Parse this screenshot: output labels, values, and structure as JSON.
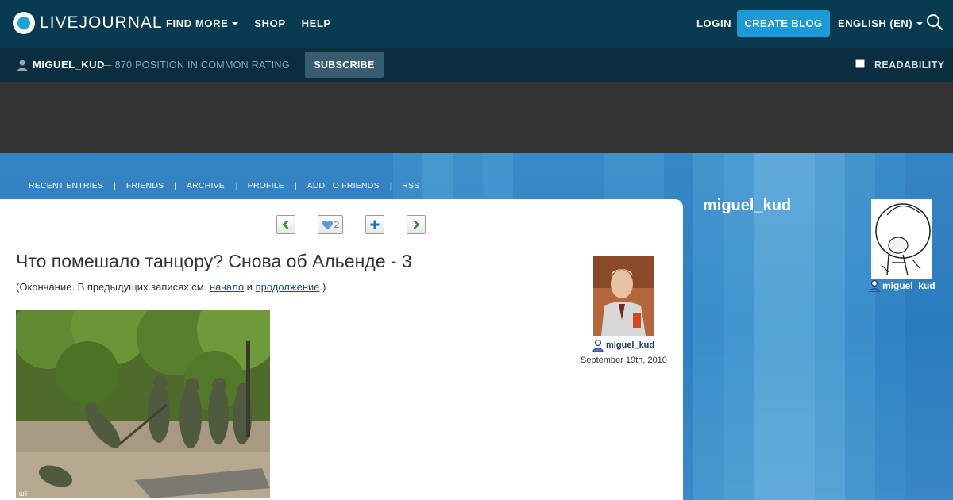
{
  "header": {
    "logo_text": "LIVEJOURNAL",
    "nav": [
      {
        "label": "FIND MORE",
        "has_dropdown": true
      },
      {
        "label": "SHOP",
        "has_dropdown": false
      },
      {
        "label": "HELP",
        "has_dropdown": false
      }
    ],
    "login": "LOGIN",
    "create_blog": "CREATE BLOG",
    "language": "ENGLISH (EN)",
    "search_icon": "search-icon"
  },
  "subheader": {
    "username": "MIGUEL_KUD",
    "rating": "— 870 POSITION IN COMMON RATING",
    "subscribe": "SUBSCRIBE",
    "readability": "READABILITY",
    "readability_checked": false
  },
  "blog_nav": {
    "items": [
      "RECENT ENTRIES",
      "FRIENDS",
      "ARCHIVE",
      "PROFILE",
      "ADD TO FRIENDS",
      "RSS"
    ]
  },
  "entry": {
    "like_count": "2",
    "title": "Что помешало танцору? Снова об Альенде - 3",
    "intro_before": "(Окончание. В предыдущих записях см. ",
    "link1": "начало",
    "intro_mid": " и ",
    "link2": "продолжение",
    "intro_after": ".)",
    "photo_caption": "Шб",
    "author": "miguel_kud",
    "date": "September 19th, 2010"
  },
  "sidebar": {
    "title": "miguel_kud",
    "username": "miguel_kud"
  },
  "colors": {
    "topbar": "#083a52",
    "subbar": "#0b2d40",
    "accent": "#1a9ad6",
    "background": "#2a7dc0"
  }
}
